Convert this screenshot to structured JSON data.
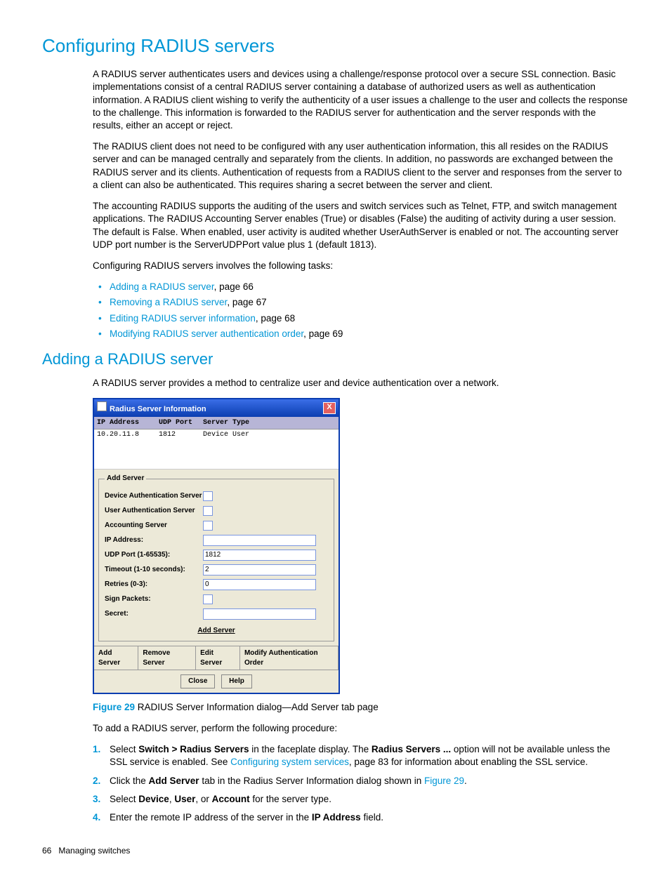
{
  "h1": "Configuring RADIUS servers",
  "p1": "A RADIUS server authenticates users and devices using a challenge/response protocol over a secure SSL connection. Basic implementations consist of a central RADIUS server containing a database of authorized users as well as authentication information. A RADIUS client wishing to verify the authenticity of a user issues a challenge to the user and collects the response to the challenge. This information is forwarded to the RADIUS server for authentication and the server responds with the results, either an accept or reject.",
  "p2": "The RADIUS client does not need to be configured with any user authentication information, this all resides on the RADIUS server and can be managed centrally and separately from the clients. In addition, no passwords are exchanged between the RADIUS server and its clients. Authentication of requests from a RADIUS client to the server and responses from the server to a client can also be authenticated. This requires sharing a secret between the server and client.",
  "p3": "The accounting RADIUS supports the auditing of the users and switch services such as Telnet, FTP, and switch management applications. The RADIUS Accounting Server enables (True) or disables (False) the auditing of activity during a user session. The default is False. When enabled, user activity is audited whether UserAuthServer is enabled or not. The accounting server UDP port number is the ServerUDPPort value plus 1 (default 1813).",
  "p4": "Configuring RADIUS servers involves the following tasks:",
  "bullets": [
    {
      "link": "Adding a RADIUS server",
      "rest": ", page 66"
    },
    {
      "link": "Removing a RADIUS server",
      "rest": ", page 67"
    },
    {
      "link": "Editing RADIUS server information",
      "rest": ", page 68"
    },
    {
      "link": "Modifying RADIUS server authentication order",
      "rest": ", page 69"
    }
  ],
  "h2": "Adding a RADIUS server",
  "p5": "A RADIUS server provides a method to centralize user and device authentication over a network.",
  "dialog": {
    "title": "Radius Server Information",
    "close": "X",
    "cols": {
      "ip": "IP Address",
      "port": "UDP Port",
      "type": "Server Type"
    },
    "row": {
      "ip": "10.20.11.8",
      "port": "1812",
      "type": "Device  User"
    },
    "fieldset": "Add Server",
    "labels": {
      "das": "Device Authentication Server",
      "uas": "User Authentication Server",
      "acct": "Accounting Server",
      "ip": "IP Address:",
      "udp": "UDP Port (1-65535):",
      "timeout": "Timeout (1-10 seconds):",
      "retries": "Retries (0-3):",
      "sign": "Sign Packets:",
      "secret": "Secret:"
    },
    "values": {
      "udp": "1812",
      "timeout": "2",
      "retries": "0"
    },
    "addbtn": "Add Server",
    "tabs": [
      "Add Server",
      "Remove Server",
      "Edit Server",
      "Modify Authentication Order"
    ],
    "btns": [
      "Close",
      "Help"
    ]
  },
  "figlabel": "Figure 29",
  "figrest": "  RADIUS Server Information dialog—Add Server tab page",
  "p6": "To add a RADIUS server, perform the following procedure:",
  "steps": {
    "s1a": "Select ",
    "s1b": "Switch > Radius Servers",
    "s1c": " in the faceplate display. The ",
    "s1d": "Radius Servers ...",
    "s1e": " option will not be available unless the SSL service is enabled. See ",
    "s1link": "Configuring system services",
    "s1f": ", page 83 for information about enabling the SSL service.",
    "s2a": "Click the ",
    "s2b": "Add Server",
    "s2c": " tab in the Radius Server Information dialog shown in ",
    "s2link": "Figure 29",
    "s2d": ".",
    "s3a": "Select ",
    "s3b": "Device",
    "s3c": ", ",
    "s3d": "User",
    "s3e": ", or ",
    "s3f": "Account",
    "s3g": " for the server type.",
    "s4a": "Enter the remote IP address of the server in the ",
    "s4b": "IP Address",
    "s4c": " field."
  },
  "footer": {
    "page": "66",
    "chapter": "Managing switches"
  }
}
